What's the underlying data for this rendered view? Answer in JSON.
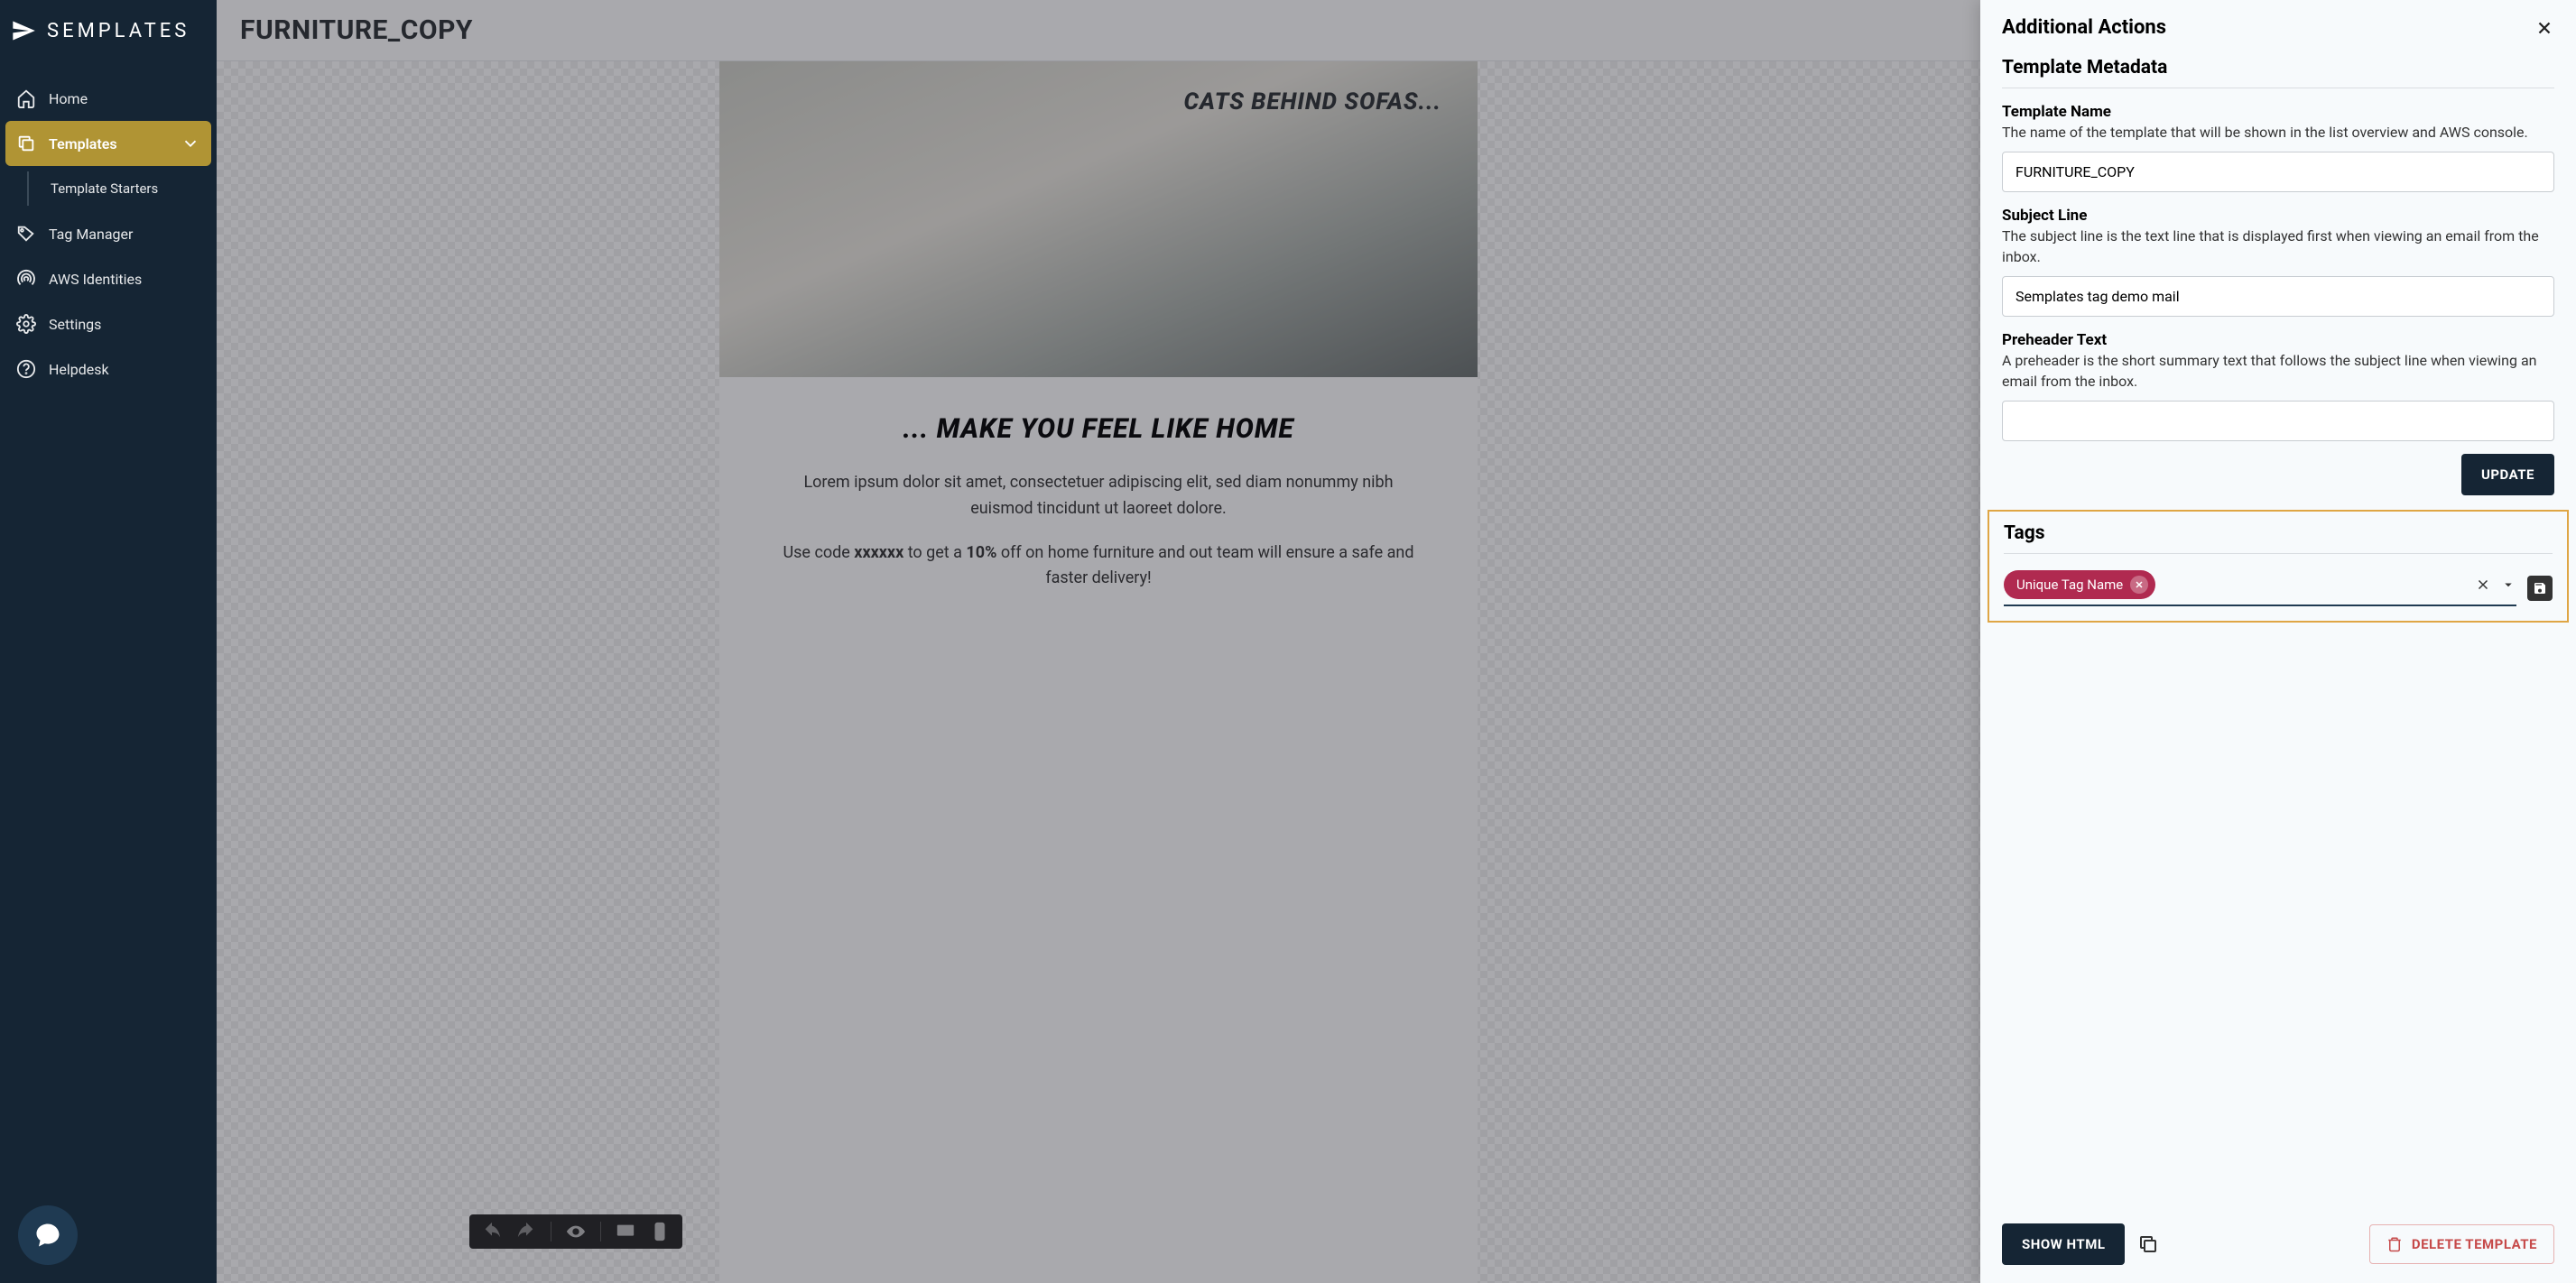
{
  "brand": "SEMPLATES",
  "sidebar": {
    "home": "Home",
    "templates": "Templates",
    "starters": "Template Starters",
    "tag_manager": "Tag Manager",
    "aws_identities": "AWS Identities",
    "settings": "Settings",
    "helpdesk": "Helpdesk"
  },
  "page_title": "FURNITURE_COPY",
  "email_preview": {
    "hero_headline": "CATS BEHIND SOFAS...",
    "sub_headline": "... MAKE YOU FEEL LIKE HOME",
    "para1": "Lorem ipsum dolor sit amet, consectetuer adipiscing elit, sed diam nonummy nibh euismod tincidunt ut laoreet dolore.",
    "para2_prefix": "Use code ",
    "para2_code": "xxxxxx",
    "para2_mid1": " to get a ",
    "para2_bold": "10%",
    "para2_mid2": " off on home furniture and out team will ensure a safe and faster delivery!"
  },
  "panel": {
    "title": "Additional Actions",
    "metadata_heading": "Template Metadata",
    "fields": {
      "template_name": {
        "label": "Template Name",
        "desc": "The name of the template that will be shown in the list overview and AWS console.",
        "value": "FURNITURE_COPY"
      },
      "subject_line": {
        "label": "Subject Line",
        "desc": "The subject line is the text line that is displayed first when viewing an email from the inbox.",
        "value": "Semplates tag demo mail"
      },
      "preheader": {
        "label": "Preheader Text",
        "desc": "A preheader is the short summary text that follows the subject line when viewing an email from the inbox.",
        "value": ""
      }
    },
    "update_btn": "UPDATE",
    "tags": {
      "heading": "Tags",
      "chip": "Unique Tag Name",
      "input_value": ""
    },
    "footer": {
      "show_html": "SHOW HTML",
      "delete": "DELETE TEMPLATE"
    }
  }
}
